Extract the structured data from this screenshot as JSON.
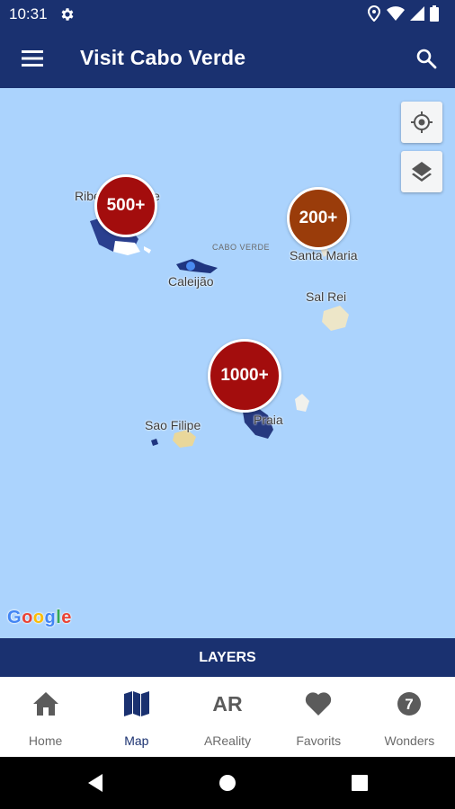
{
  "status_bar": {
    "time": "10:31"
  },
  "app_bar": {
    "title": "Visit Cabo Verde"
  },
  "map": {
    "country_label": "CABO VERDE",
    "place_labels": {
      "ribeira": "Ribeira Grande",
      "caleijao": "Caleijão",
      "santa_maria": "Santa Maria",
      "sal_rei": "Sal Rei",
      "praia": "Praia",
      "sao_filipe": "Sao Filipe"
    },
    "clusters": {
      "c500": "500+",
      "c200": "200+",
      "c1000": "1000+"
    },
    "google_logo": [
      "G",
      "o",
      "o",
      "g",
      "l",
      "e"
    ],
    "colors": {
      "water": "#abd3fd",
      "cluster_red": "#a30d0d",
      "cluster_brown": "#9a3c0a",
      "brand": "#1a3170"
    }
  },
  "layers_bar": {
    "label": "LAYERS"
  },
  "bottom_nav": {
    "home": {
      "label": "Home",
      "icon": "home-icon"
    },
    "map": {
      "label": "Map",
      "icon": "map-icon"
    },
    "areality": {
      "label": "AReality",
      "icon_text": "AR"
    },
    "favorits": {
      "label": "Favorits",
      "icon": "heart-icon"
    },
    "wonders": {
      "label": "Wonders",
      "icon_text": "7"
    }
  }
}
